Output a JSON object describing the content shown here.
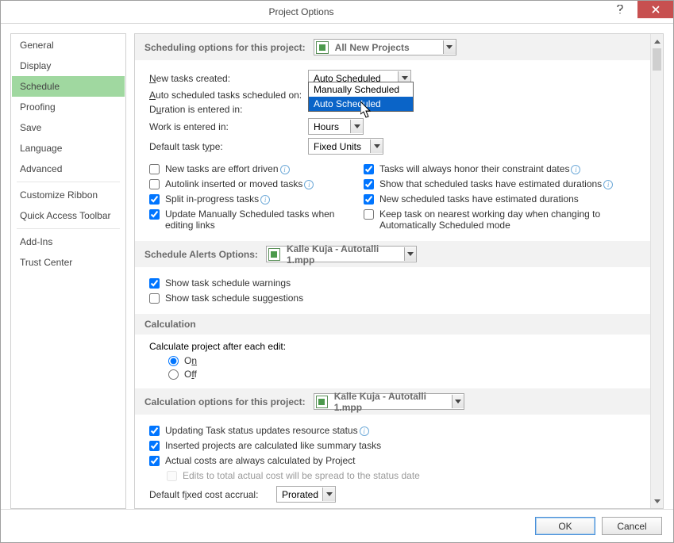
{
  "window": {
    "title": "Project Options"
  },
  "sidebar": {
    "items": [
      {
        "label": "General"
      },
      {
        "label": "Display"
      },
      {
        "label": "Schedule",
        "selected": true
      },
      {
        "label": "Proofing"
      },
      {
        "label": "Save"
      },
      {
        "label": "Language"
      },
      {
        "label": "Advanced"
      },
      {
        "_sep": true
      },
      {
        "label": "Customize Ribbon"
      },
      {
        "label": "Quick Access Toolbar"
      },
      {
        "_sep": true
      },
      {
        "label": "Add-Ins"
      },
      {
        "label": "Trust Center"
      }
    ]
  },
  "s1": {
    "title": "Scheduling options for this project:",
    "project": "All New Projects",
    "r": {
      "new_tasks_lbl": "New tasks created:",
      "new_tasks_val": "Auto Scheduled",
      "auto_sched_lbl": "Auto scheduled tasks scheduled on:",
      "duration_lbl": "Duration is entered in:",
      "work_lbl": "Work is entered in:",
      "work_val": "Hours",
      "default_type_lbl": "Default task type:",
      "default_type_val": "Fixed Units"
    },
    "dd_opts": [
      "Manually Scheduled",
      "Auto Scheduled"
    ],
    "chk": {
      "effort": "New tasks are effort driven",
      "autolink": "Autolink inserted or moved tasks",
      "split": "Split in-progress tasks",
      "update_manual": "Update Manually Scheduled tasks when editing links",
      "honor": "Tasks will always honor their constraint dates",
      "show_est": "Show that scheduled tasks have estimated durations",
      "new_est": "New scheduled tasks have estimated durations",
      "keep_near": "Keep task on nearest working day when changing to Automatically Scheduled mode"
    }
  },
  "s2": {
    "title": "Schedule Alerts Options:",
    "project": "Kalle Kuja - Autotalli 1.mpp",
    "chk": {
      "warn": "Show task schedule warnings",
      "sugg": "Show task schedule suggestions"
    }
  },
  "s3": {
    "title": "Calculation",
    "calc_lbl": "Calculate project after each edit:",
    "on": "On",
    "off": "Off"
  },
  "s4": {
    "title": "Calculation options for this project:",
    "project": "Kalle Kuja - Autotalli 1.mpp",
    "chk": {
      "upd": "Updating Task status updates resource status",
      "ins": "Inserted projects are calculated like summary tasks",
      "act": "Actual costs are always calculated by Project",
      "edits": "Edits to total actual cost will be spread to the status date"
    },
    "accrual_lbl": "Default fixed cost accrual:",
    "accrual_val": "Prorated"
  },
  "footer": {
    "ok": "OK",
    "cancel": "Cancel"
  }
}
